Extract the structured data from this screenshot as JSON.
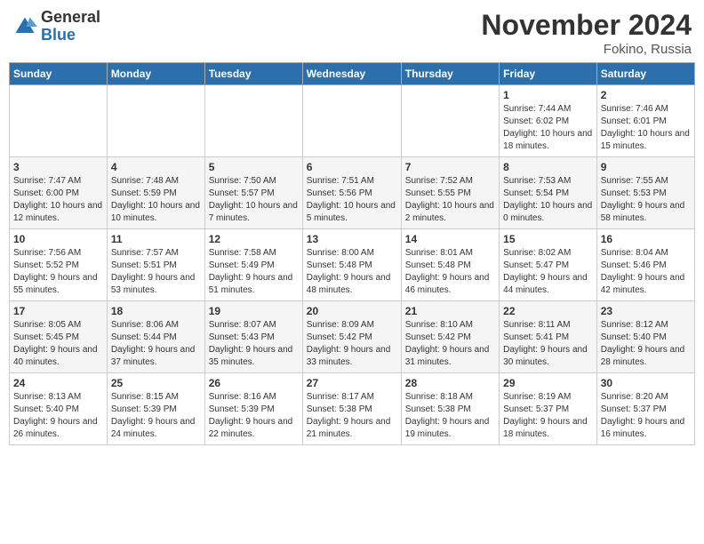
{
  "header": {
    "logo": {
      "general": "General",
      "blue": "Blue"
    },
    "month": "November 2024",
    "location": "Fokino, Russia"
  },
  "days_of_week": [
    "Sunday",
    "Monday",
    "Tuesday",
    "Wednesday",
    "Thursday",
    "Friday",
    "Saturday"
  ],
  "weeks": [
    [
      null,
      null,
      null,
      null,
      null,
      {
        "day": "1",
        "sunrise": "7:44 AM",
        "sunset": "6:02 PM",
        "daylight": "10 hours and 18 minutes."
      },
      {
        "day": "2",
        "sunrise": "7:46 AM",
        "sunset": "6:01 PM",
        "daylight": "10 hours and 15 minutes."
      }
    ],
    [
      {
        "day": "3",
        "sunrise": "7:47 AM",
        "sunset": "6:00 PM",
        "daylight": "10 hours and 12 minutes."
      },
      {
        "day": "4",
        "sunrise": "7:48 AM",
        "sunset": "5:59 PM",
        "daylight": "10 hours and 10 minutes."
      },
      {
        "day": "5",
        "sunrise": "7:50 AM",
        "sunset": "5:57 PM",
        "daylight": "10 hours and 7 minutes."
      },
      {
        "day": "6",
        "sunrise": "7:51 AM",
        "sunset": "5:56 PM",
        "daylight": "10 hours and 5 minutes."
      },
      {
        "day": "7",
        "sunrise": "7:52 AM",
        "sunset": "5:55 PM",
        "daylight": "10 hours and 2 minutes."
      },
      {
        "day": "8",
        "sunrise": "7:53 AM",
        "sunset": "5:54 PM",
        "daylight": "10 hours and 0 minutes."
      },
      {
        "day": "9",
        "sunrise": "7:55 AM",
        "sunset": "5:53 PM",
        "daylight": "9 hours and 58 minutes."
      }
    ],
    [
      {
        "day": "10",
        "sunrise": "7:56 AM",
        "sunset": "5:52 PM",
        "daylight": "9 hours and 55 minutes."
      },
      {
        "day": "11",
        "sunrise": "7:57 AM",
        "sunset": "5:51 PM",
        "daylight": "9 hours and 53 minutes."
      },
      {
        "day": "12",
        "sunrise": "7:58 AM",
        "sunset": "5:49 PM",
        "daylight": "9 hours and 51 minutes."
      },
      {
        "day": "13",
        "sunrise": "8:00 AM",
        "sunset": "5:48 PM",
        "daylight": "9 hours and 48 minutes."
      },
      {
        "day": "14",
        "sunrise": "8:01 AM",
        "sunset": "5:48 PM",
        "daylight": "9 hours and 46 minutes."
      },
      {
        "day": "15",
        "sunrise": "8:02 AM",
        "sunset": "5:47 PM",
        "daylight": "9 hours and 44 minutes."
      },
      {
        "day": "16",
        "sunrise": "8:04 AM",
        "sunset": "5:46 PM",
        "daylight": "9 hours and 42 minutes."
      }
    ],
    [
      {
        "day": "17",
        "sunrise": "8:05 AM",
        "sunset": "5:45 PM",
        "daylight": "9 hours and 40 minutes."
      },
      {
        "day": "18",
        "sunrise": "8:06 AM",
        "sunset": "5:44 PM",
        "daylight": "9 hours and 37 minutes."
      },
      {
        "day": "19",
        "sunrise": "8:07 AM",
        "sunset": "5:43 PM",
        "daylight": "9 hours and 35 minutes."
      },
      {
        "day": "20",
        "sunrise": "8:09 AM",
        "sunset": "5:42 PM",
        "daylight": "9 hours and 33 minutes."
      },
      {
        "day": "21",
        "sunrise": "8:10 AM",
        "sunset": "5:42 PM",
        "daylight": "9 hours and 31 minutes."
      },
      {
        "day": "22",
        "sunrise": "8:11 AM",
        "sunset": "5:41 PM",
        "daylight": "9 hours and 30 minutes."
      },
      {
        "day": "23",
        "sunrise": "8:12 AM",
        "sunset": "5:40 PM",
        "daylight": "9 hours and 28 minutes."
      }
    ],
    [
      {
        "day": "24",
        "sunrise": "8:13 AM",
        "sunset": "5:40 PM",
        "daylight": "9 hours and 26 minutes."
      },
      {
        "day": "25",
        "sunrise": "8:15 AM",
        "sunset": "5:39 PM",
        "daylight": "9 hours and 24 minutes."
      },
      {
        "day": "26",
        "sunrise": "8:16 AM",
        "sunset": "5:39 PM",
        "daylight": "9 hours and 22 minutes."
      },
      {
        "day": "27",
        "sunrise": "8:17 AM",
        "sunset": "5:38 PM",
        "daylight": "9 hours and 21 minutes."
      },
      {
        "day": "28",
        "sunrise": "8:18 AM",
        "sunset": "5:38 PM",
        "daylight": "9 hours and 19 minutes."
      },
      {
        "day": "29",
        "sunrise": "8:19 AM",
        "sunset": "5:37 PM",
        "daylight": "9 hours and 18 minutes."
      },
      {
        "day": "30",
        "sunrise": "8:20 AM",
        "sunset": "5:37 PM",
        "daylight": "9 hours and 16 minutes."
      }
    ]
  ]
}
